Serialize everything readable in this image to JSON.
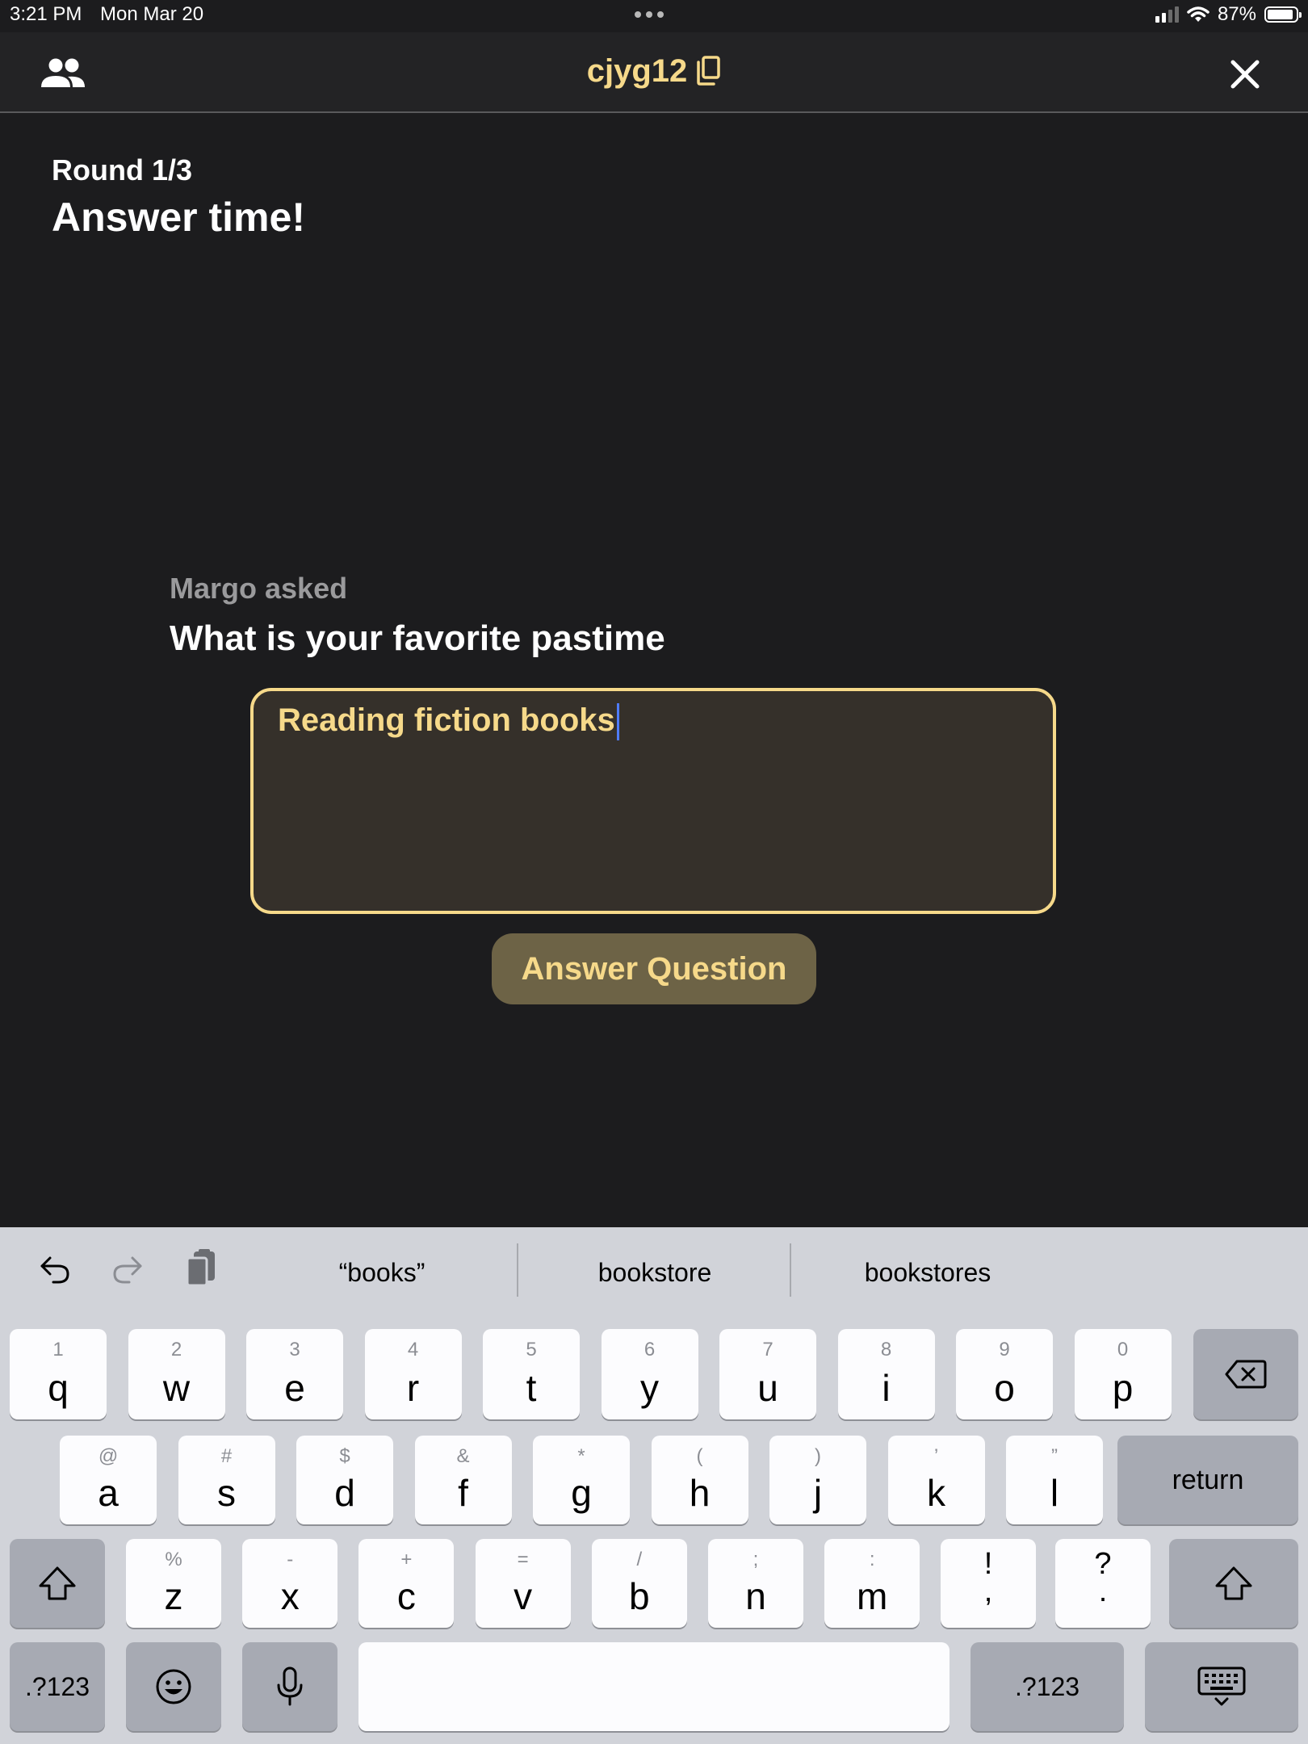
{
  "status_bar": {
    "time": "3:21 PM",
    "date": "Mon Mar 20",
    "battery": "87%"
  },
  "header": {
    "room_code": "cjyg12",
    "icons": [
      "people-icon",
      "copy-icon",
      "close-icon"
    ]
  },
  "round": {
    "label": "Round 1/3",
    "phase": "Answer time!"
  },
  "prompt": {
    "asker": "Margo asked",
    "question": "What is your favorite pastime"
  },
  "answer": {
    "value": "Reading fiction books"
  },
  "submit_button": {
    "label": "Answer Question"
  },
  "colors": {
    "accent": "#f6d98a",
    "background": "#1c1c1e",
    "button": "#6d6346",
    "input_bg": "#35302a",
    "keyboard_bg": "#d1d3d9"
  },
  "keyboard": {
    "suggestions": [
      "“books”",
      "bookstore",
      "bookstores"
    ],
    "row1": [
      {
        "main": "q",
        "sub": "1"
      },
      {
        "main": "w",
        "sub": "2"
      },
      {
        "main": "e",
        "sub": "3"
      },
      {
        "main": "r",
        "sub": "4"
      },
      {
        "main": "t",
        "sub": "5"
      },
      {
        "main": "y",
        "sub": "6"
      },
      {
        "main": "u",
        "sub": "7"
      },
      {
        "main": "i",
        "sub": "8"
      },
      {
        "main": "o",
        "sub": "9"
      },
      {
        "main": "p",
        "sub": "0"
      }
    ],
    "row2": [
      {
        "main": "a",
        "sub": "@"
      },
      {
        "main": "s",
        "sub": "#"
      },
      {
        "main": "d",
        "sub": "$"
      },
      {
        "main": "f",
        "sub": "&"
      },
      {
        "main": "g",
        "sub": "*"
      },
      {
        "main": "h",
        "sub": "("
      },
      {
        "main": "j",
        "sub": ")"
      },
      {
        "main": "k",
        "sub": "’"
      },
      {
        "main": "l",
        "sub": "”"
      }
    ],
    "row3": [
      {
        "main": "z",
        "sub": "%"
      },
      {
        "main": "x",
        "sub": "-"
      },
      {
        "main": "c",
        "sub": "+"
      },
      {
        "main": "v",
        "sub": "="
      },
      {
        "main": "b",
        "sub": "/"
      },
      {
        "main": "n",
        "sub": ";"
      },
      {
        "main": "m",
        "sub": ":"
      }
    ],
    "punct_keys": [
      {
        "top": "!",
        "bottom": ","
      },
      {
        "top": "?",
        "bottom": "."
      }
    ],
    "return_label": "return",
    "numbers_label": ".?123",
    "icons": [
      "undo-icon",
      "redo-icon",
      "paste-icon",
      "delete-icon",
      "shift-icon",
      "emoji-icon",
      "microphone-icon",
      "keyboard-dismiss-icon"
    ]
  }
}
